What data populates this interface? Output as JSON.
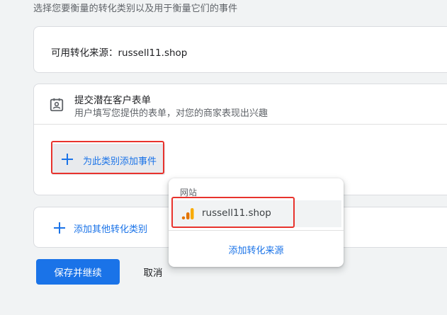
{
  "page": {
    "intro": "选择您要衡量的转化类别以及用于衡量它们的事件"
  },
  "source_card": {
    "text": "可用转化来源：russell11.shop"
  },
  "category_card": {
    "icon": "contact-form-icon",
    "title": "提交潜在客户表单",
    "subtitle": "用户填写您提供的表单，对您的商家表现出兴趣",
    "add_event_label": "为此类别添加事件"
  },
  "other_card": {
    "label": "添加其他转化类别"
  },
  "actions": {
    "save_label": "保存并继续",
    "cancel_label": "取消"
  },
  "popup": {
    "header": "网站",
    "item_icon": "google-analytics-icon",
    "item_label": "russell11.shop",
    "footer": "添加转化来源"
  },
  "colors": {
    "accent": "#1a73e8",
    "highlight": "#e8332d",
    "analytics_orange": "#f9ab00",
    "analytics_dark": "#e37400"
  }
}
